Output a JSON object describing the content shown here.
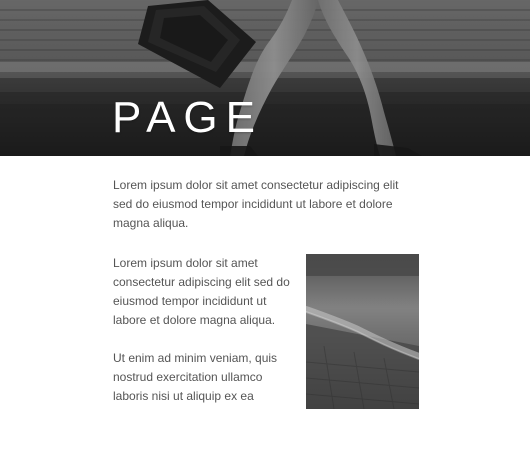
{
  "hero": {
    "title": "PAGE"
  },
  "content": {
    "paragraph_intro": "Lorem ipsum dolor sit amet consectetur adipiscing elit sed do eiusmod tempor incididunt ut labore et dolore magna aliqua.",
    "two_col": {
      "left_paragraphs": [
        "Lorem ipsum dolor sit amet consectetur adipiscing elit sed do eiusmod tempor incididunt ut labore et dolore magna aliqua.",
        "Ut enim ad minim veniam, quis nostrud exercitation ullamco laboris nisi ut aliquip ex ea"
      ]
    }
  },
  "colors": {
    "background": "#ffffff",
    "text": "#555555",
    "hero_text": "#ffffff"
  }
}
